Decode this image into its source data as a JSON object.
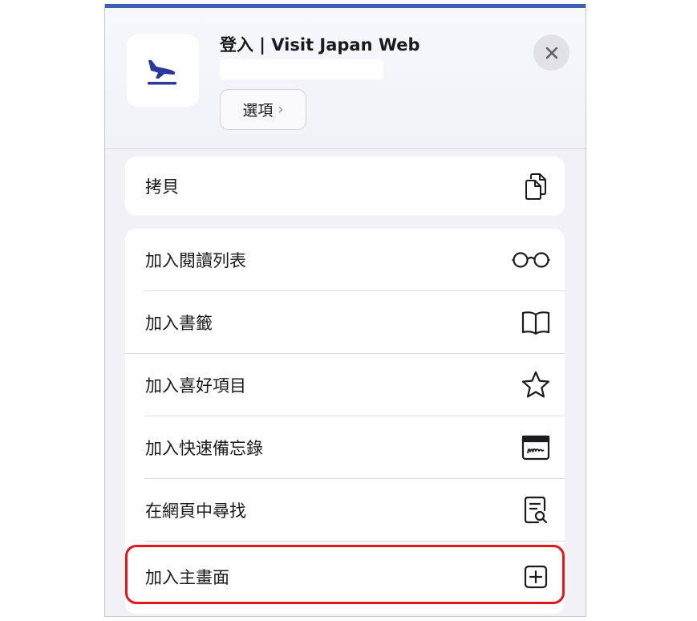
{
  "sheet": {
    "site_title": "登入 | Visit Japan Web",
    "url": "",
    "options_label": "選項",
    "options_chevron": "›"
  },
  "icons": {
    "app": "airplane-arrival-icon",
    "close": "close-icon"
  },
  "copy_group": [
    {
      "label": "拷貝",
      "icon": "copy-icon"
    }
  ],
  "actions": [
    {
      "label": "加入閱讀列表",
      "icon": "glasses-icon"
    },
    {
      "label": "加入書籤",
      "icon": "book-icon"
    },
    {
      "label": "加入喜好項目",
      "icon": "star-icon"
    },
    {
      "label": "加入快速備忘錄",
      "icon": "quick-note-icon"
    },
    {
      "label": "在網頁中尋找",
      "icon": "find-in-page-icon"
    },
    {
      "label": "加入主畫面",
      "icon": "add-square-icon"
    }
  ],
  "colors": {
    "accent_blue": "#2a3a9c",
    "highlight_red": "#e3161b",
    "background": "#f2f2f6"
  }
}
